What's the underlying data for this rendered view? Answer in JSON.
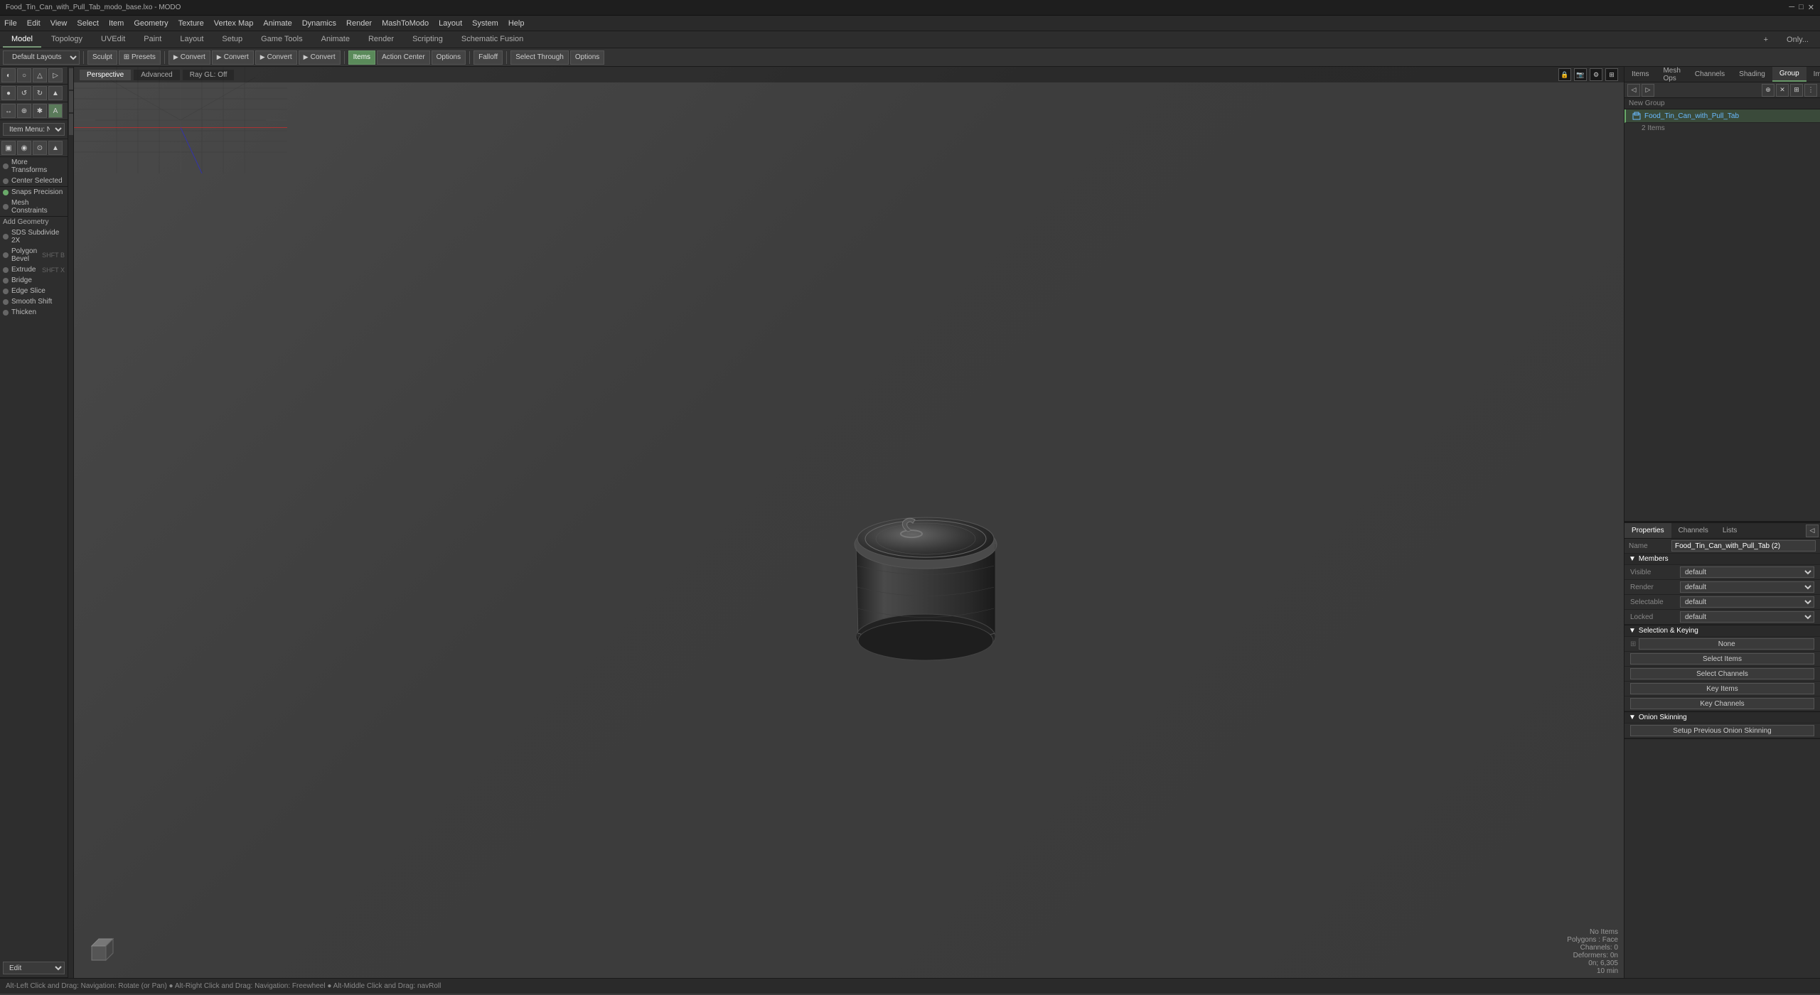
{
  "window": {
    "title": "Food_Tin_Can_with_Pull_Tab_modo_base.lxo - MODO"
  },
  "top_menu": {
    "items": [
      "File",
      "Edit",
      "View",
      "Select",
      "Item",
      "Geometry",
      "Texture",
      "Vertex Map",
      "Animate",
      "Dynamics",
      "Render",
      "MashToModo",
      "Layout",
      "System",
      "Help"
    ]
  },
  "toolbar": {
    "layout_dropdown": "Default Layouts",
    "sculpt_label": "Sculpt",
    "presets_label": "⊞ Presets",
    "convert_labels": [
      "Convert",
      "Convert",
      "Convert",
      "Convert"
    ],
    "items_label": "Items",
    "action_center_label": "Action Center",
    "options_label": "Options",
    "falloff_label": "Falloff",
    "select_through_label": "Select Through",
    "options2_label": "Options"
  },
  "top_tabs": {
    "tabs": [
      "Model",
      "Topology",
      "UVEdit",
      "Paint",
      "Layout",
      "Setup",
      "Game Tools",
      "Animate",
      "Render",
      "Scripting",
      "Schematic Fusion"
    ],
    "active": "Model",
    "plus_btn": "+",
    "right_label": "Only..."
  },
  "viewport_tabs": {
    "items": [
      "Perspective",
      "Advanced",
      "Ray GL: Off"
    ],
    "active": "Perspective"
  },
  "viewport": {
    "status": {
      "no_items": "No Items",
      "polygons": "Polygons : Face",
      "channels": "Channels: 0",
      "deformers": "Deformers: 0n",
      "position": "0n; 6,305",
      "time": "10 min"
    }
  },
  "left_sidebar": {
    "tool_icons": [
      "◐",
      "○",
      "△",
      "▷",
      "●",
      "⟲",
      "⟳",
      "▲"
    ],
    "tool_icons2": [
      "↔",
      "⊕",
      "✱",
      "A"
    ],
    "tool_icons3": [
      "▣",
      "◉",
      "⊙",
      "▲"
    ],
    "item_menu": "Item Menu: New Item",
    "more_transforms": "More Transforms",
    "center_selected": "Center Selected",
    "snaps_precision": "Snaps Precision",
    "mesh_constraints": "Mesh Constraints",
    "add_geometry": "Add Geometry",
    "tools": [
      {
        "name": "SDS Subdivide 2X",
        "shortcut": ""
      },
      {
        "name": "Polygon Bevel",
        "shortcut": "SHFT B"
      },
      {
        "name": "Extrude",
        "shortcut": "SHFT X"
      },
      {
        "name": "Bridge",
        "shortcut": ""
      },
      {
        "name": "Edge Slice",
        "shortcut": ""
      },
      {
        "name": "Smooth Shift",
        "shortcut": ""
      },
      {
        "name": "Thicken",
        "shortcut": ""
      }
    ],
    "edit_dropdown": "Edit"
  },
  "right_panel": {
    "tabs": [
      "Items",
      "Mesh Ops",
      "Channels",
      "Shading",
      "Group",
      "Images"
    ],
    "active_tab": "Group",
    "toolbar_btns": [
      "◁",
      "▷",
      "⊕",
      "✕",
      "⊞",
      "⋮"
    ],
    "new_group_label": "New Group",
    "groups": [
      {
        "name": "Food_Tin_Can_with_Pull_Tab",
        "count": "2 Items",
        "icon": "📦",
        "highlight": true
      }
    ]
  },
  "properties": {
    "tabs": [
      "Properties",
      "Channels",
      "Lists"
    ],
    "active_tab": "Properties",
    "name_label": "Name",
    "name_value": "Food_Tin_Can_with_Pull_Tab (2)",
    "sections": [
      {
        "title": "Members",
        "fields": [
          {
            "label": "Visible",
            "value": "default"
          },
          {
            "label": "Render",
            "value": "default"
          },
          {
            "label": "Selectable",
            "value": "default"
          },
          {
            "label": "Locked",
            "value": "default"
          }
        ]
      },
      {
        "title": "Selection & Keying",
        "fields": [],
        "buttons": [
          {
            "label": "None",
            "icon": "⊞"
          },
          {
            "label": "Select Items"
          },
          {
            "label": "Select Channels"
          },
          {
            "label": "Key Items"
          },
          {
            "label": "Key Channels"
          }
        ]
      },
      {
        "title": "Onion Skinning",
        "fields": [],
        "buttons": [
          {
            "label": "Setup Previous Onion Skinning"
          }
        ]
      }
    ]
  },
  "status_bar": {
    "text": "Alt-Left Click and Drag: Navigation: Rotate (or Pan) ● Alt-Right Click and Drag: Navigation: Freewheel ● Alt-Middle Click and Drag: navRoll"
  },
  "colors": {
    "accent_green": "#6aaa6a",
    "accent_blue": "#6abaff",
    "bg_dark": "#2a2a2a",
    "bg_mid": "#333333",
    "bg_light": "#444444"
  }
}
